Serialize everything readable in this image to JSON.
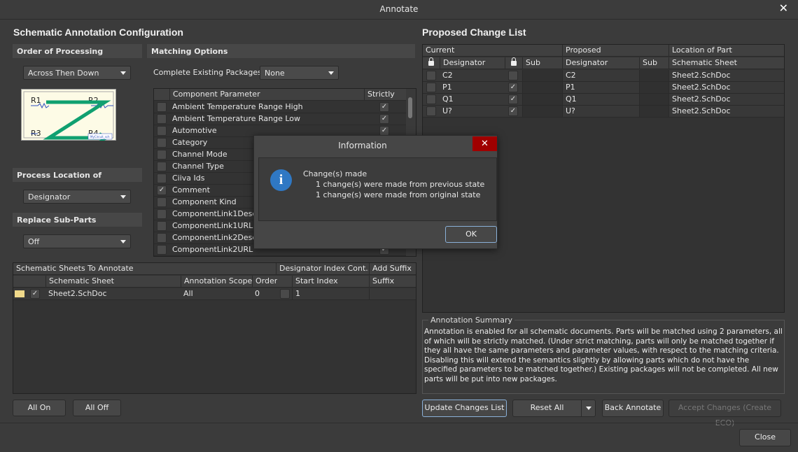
{
  "window": {
    "title": "Annotate",
    "close_icon": "close-icon"
  },
  "left": {
    "title": "Schematic Annotation Configuration",
    "order": {
      "header": "Order of Processing",
      "value": "Across Then Down",
      "diagram_labels": [
        "R1",
        "R2",
        "R3",
        "R4"
      ],
      "diagram_caption": "MyCircuit_sch"
    },
    "location": {
      "header": "Process Location of",
      "value": "Designator"
    },
    "subparts": {
      "header": "Replace Sub-Parts",
      "value": "Off"
    },
    "matching": {
      "header": "Matching Options",
      "packages_label": "Complete Existing Packages",
      "packages_value": "None",
      "col_param": "Component Parameter",
      "col_strict": "Strictly",
      "rows": [
        {
          "name": "Ambient Temperature Range High",
          "checked": false,
          "strict": true
        },
        {
          "name": "Ambient Temperature Range Low",
          "checked": false,
          "strict": true
        },
        {
          "name": "Automotive",
          "checked": false,
          "strict": true
        },
        {
          "name": "Category",
          "checked": false,
          "strict": false
        },
        {
          "name": "Channel Mode",
          "checked": false,
          "strict": false
        },
        {
          "name": "Channel Type",
          "checked": false,
          "strict": false
        },
        {
          "name": "Ciiva Ids",
          "checked": false,
          "strict": false
        },
        {
          "name": "Comment",
          "checked": true,
          "strict": false
        },
        {
          "name": "Component Kind",
          "checked": false,
          "strict": false
        },
        {
          "name": "ComponentLink1Description",
          "checked": false,
          "strict": false
        },
        {
          "name": "ComponentLink1URL",
          "checked": false,
          "strict": false
        },
        {
          "name": "ComponentLink2Description",
          "checked": false,
          "strict": false
        },
        {
          "name": "ComponentLink2URL",
          "checked": false,
          "strict": true
        }
      ]
    },
    "sheets": {
      "group1": "Schematic Sheets To Annotate",
      "group2": "Designator Index Cont...",
      "group3": "Add Suffix",
      "cols": [
        "Schematic Sheet",
        "Annotation Scope",
        "Order",
        "Start Index",
        "Suffix"
      ],
      "rows": [
        {
          "sheet": "Sheet2.SchDoc",
          "scope": "All",
          "order": "0",
          "start": "1",
          "suffix": ""
        }
      ]
    },
    "all_on": "All On",
    "all_off": "All Off"
  },
  "right": {
    "title": "Proposed Change List",
    "groups": [
      "Current",
      "Proposed",
      "Location of Part"
    ],
    "cols": [
      "Designator",
      "Sub",
      "Designator",
      "Sub",
      "Schematic Sheet"
    ],
    "rows": [
      {
        "cur": "C2",
        "lock2": false,
        "prop": "C2",
        "sheet": "Sheet2.SchDoc"
      },
      {
        "cur": "P1",
        "lock2": true,
        "prop": "P1",
        "sheet": "Sheet2.SchDoc"
      },
      {
        "cur": "Q1",
        "lock2": true,
        "prop": "Q1",
        "sheet": "Sheet2.SchDoc"
      },
      {
        "cur": "U?",
        "lock2": true,
        "prop": "U?",
        "sheet": "Sheet2.SchDoc"
      }
    ],
    "summary_title": "Annotation Summary",
    "summary": "Annotation is enabled for all schematic documents. Parts will be matched using 2 parameters, all of which will be strictly matched. (Under strict matching, parts will only be matched together if they all have the same parameters and parameter values, with respect to the matching criteria. Disabling this will extend the semantics slightly by allowing parts which do not have the specified parameters to be matched together.) Existing packages will not be completed. All new parts will be put into new packages.",
    "update": "Update Changes List",
    "reset": "Reset All",
    "back": "Back Annotate",
    "accept": "Accept Changes (Create ECO)"
  },
  "close": "Close",
  "dialog": {
    "title": "Information",
    "heading": "Change(s) made",
    "line1": "1 change(s) were made from previous state",
    "line2": "1 change(s) were made from original state",
    "ok": "OK",
    "icon": "info-icon",
    "close_color": "#a00000"
  }
}
